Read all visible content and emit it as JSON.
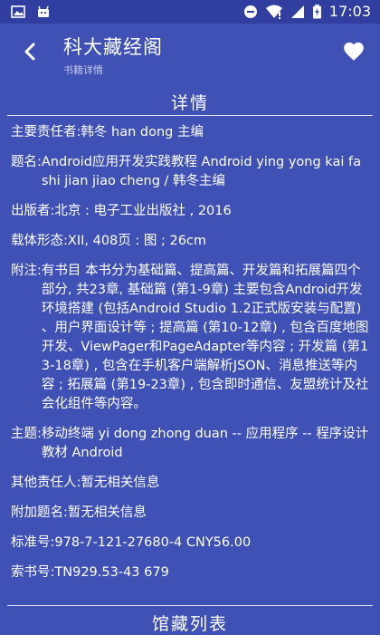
{
  "status": {
    "time": "17:03"
  },
  "appbar": {
    "title": "科大藏经阁",
    "subtitle": "书籍详情"
  },
  "section": {
    "title": "详情"
  },
  "details": [
    {
      "label": "主要责任者: ",
      "value": "韩冬 han dong 主编"
    },
    {
      "label": "题名: ",
      "value": "Android应用开发实践教程 Android ying yong kai fa shi jian jiao cheng / 韩冬主编"
    },
    {
      "label": "出版者: ",
      "value": "北京 : 电子工业出版社 , 2016"
    },
    {
      "label": "载体形态: ",
      "value": "XII, 408页 : 图 ; 26cm"
    },
    {
      "label": "附注: ",
      "value": "有书目 本书分为基础篇、提高篇、开发篇和拓展篇四个部分, 共23章, 基础篇 (第1-9章) 主要包含Android开发环境搭建 (包括Android Studio 1.2正式版安装与配置) 、用户界面设计等 ; 提高篇 (第10-12章) , 包含百度地图开发、ViewPager和PageAdapter等内容 ; 开发篇 (第13-18章) , 包含在手机客户端解析JSON、消息推送等内容 ; 拓展篇 (第19-23章) , 包含即时通信、友盟统计及社会化组件等内容。"
    },
    {
      "label": "主题: ",
      "value": "移动终端 yi dong zhong duan -- 应用程序 -- 程序设计 教材 Android"
    },
    {
      "label": "其他责任人: ",
      "value": "暂无相关信息"
    },
    {
      "label": "附加题名: ",
      "value": "暂无相关信息"
    },
    {
      "label": "标准号: ",
      "value": "978-7-121-27680-4 CNY56.00"
    },
    {
      "label": "索书号: ",
      "value": "TN929.53-43 679"
    }
  ],
  "bottom_section": {
    "title": "馆藏列表"
  }
}
